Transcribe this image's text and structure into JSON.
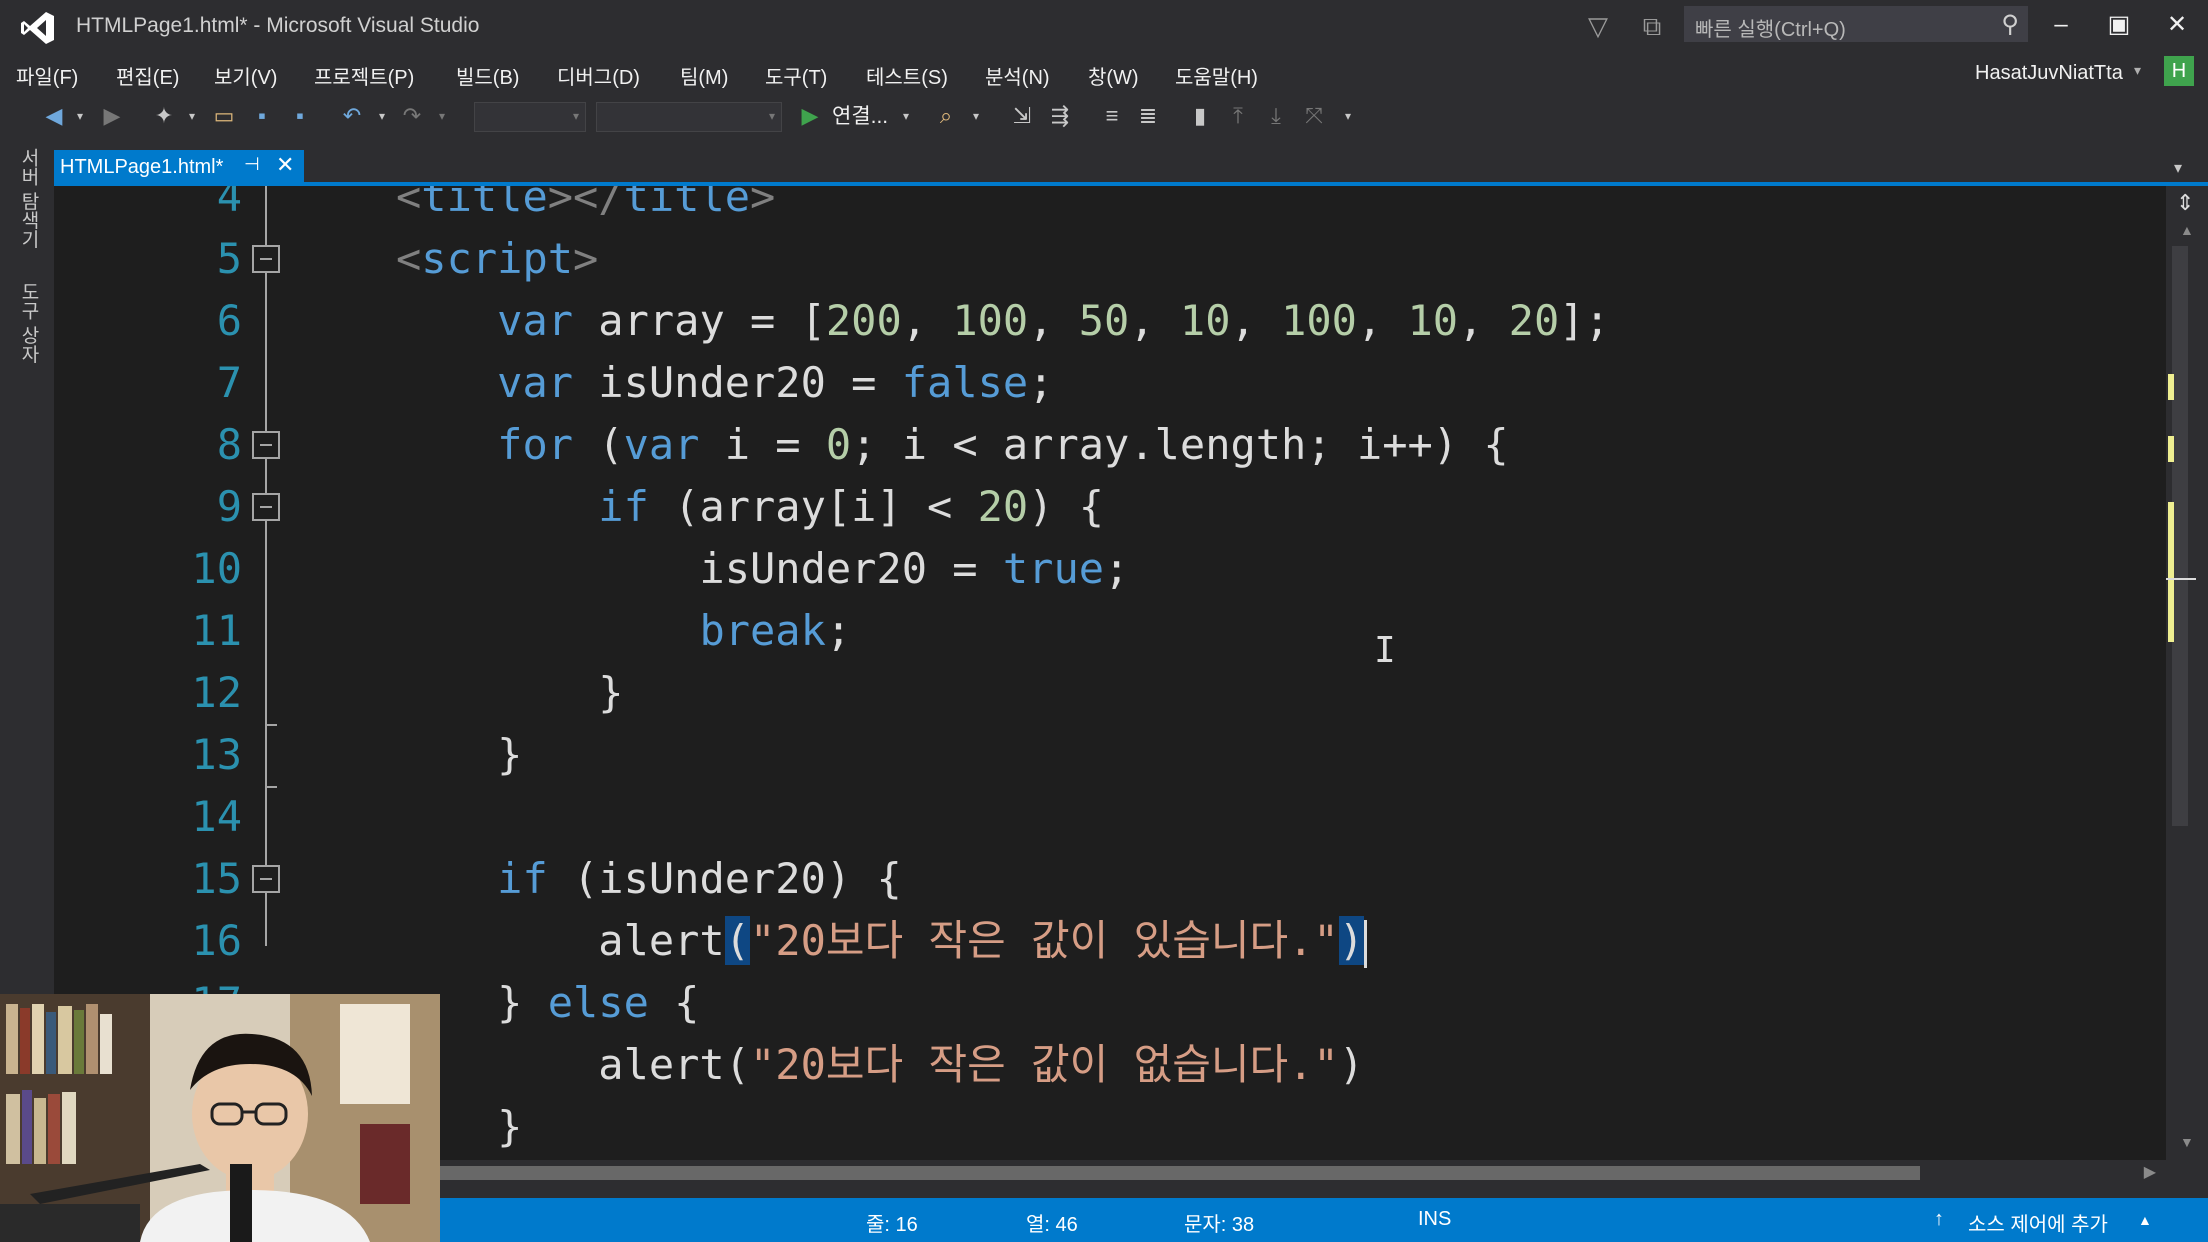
{
  "window": {
    "title": "HTMLPage1.html* - Microsoft Visual Studio",
    "quick_launch_placeholder": "빠른 실행(Ctrl+Q)",
    "user_name": "HasatJuvNiatTta",
    "avatar_letter": "H"
  },
  "menu": [
    "파일(F)",
    "편집(E)",
    "보기(V)",
    "프로젝트(P)",
    "빌드(B)",
    "디버그(D)",
    "팀(M)",
    "도구(T)",
    "테스트(S)",
    "분석(N)",
    "창(W)",
    "도움말(H)"
  ],
  "toolbar": {
    "run_label": "연결..."
  },
  "sidebar": {
    "server_explorer": "서버 탐색기",
    "toolbox": "도구 상자"
  },
  "tab": {
    "label": "HTMLPage1.html*"
  },
  "code": {
    "lines": [
      {
        "n": "4"
      },
      {
        "n": "5"
      },
      {
        "n": "6"
      },
      {
        "n": "7"
      },
      {
        "n": "8"
      },
      {
        "n": "9"
      },
      {
        "n": "10"
      },
      {
        "n": "11"
      },
      {
        "n": "12"
      },
      {
        "n": "13"
      },
      {
        "n": "14"
      },
      {
        "n": "15"
      },
      {
        "n": "16"
      },
      {
        "n": "17"
      }
    ]
  },
  "status": {
    "line": "줄: 16",
    "col": "열: 46",
    "ch": "문자: 38",
    "mode": "INS",
    "source_control": "소스 제어에 추가"
  },
  "colors": {
    "accent": "#007acc",
    "editor_bg": "#1e1e1e",
    "keyword": "#569cd6",
    "number": "#b5cea8",
    "string": "#d69d85",
    "line_number": "#2b91af"
  }
}
